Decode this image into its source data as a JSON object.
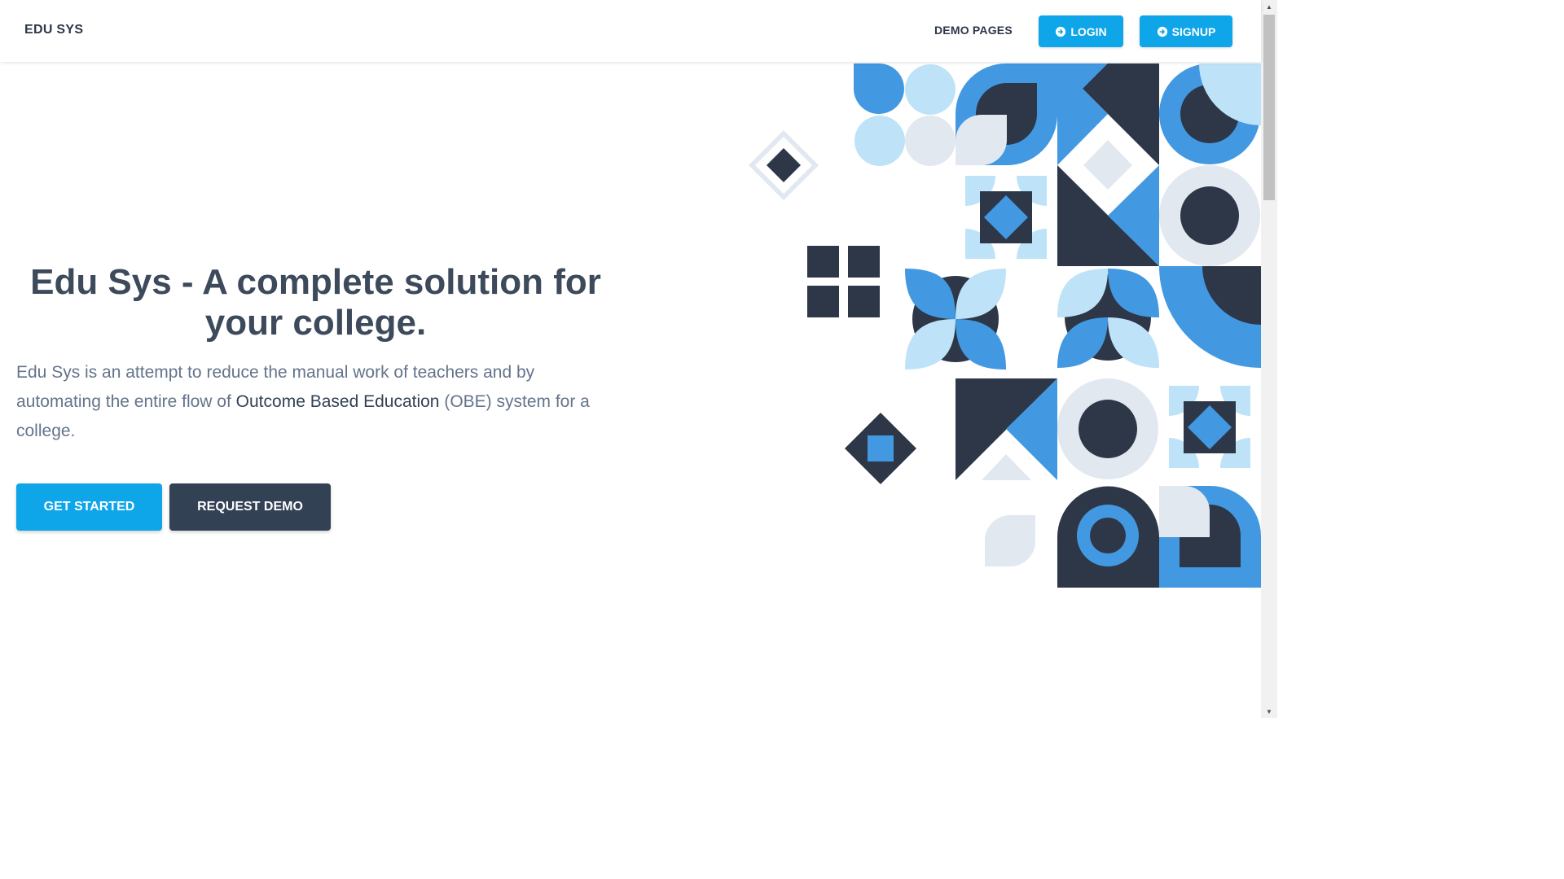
{
  "navbar": {
    "brand": "EDU SYS",
    "demo_pages": "DEMO PAGES",
    "login_label": "LOGIN",
    "signup_label": "SIGNUP"
  },
  "hero": {
    "title": "Edu Sys - A complete solution for your college.",
    "desc_part1": "Edu Sys is an attempt to reduce the manual work of teachers and by automating the entire flow of ",
    "desc_highlight": "Outcome Based Education",
    "desc_part2": " (OBE) system for a college.",
    "get_started": "GET STARTED",
    "request_demo": "REQUEST DEMO"
  },
  "colors": {
    "primary": "#0ea5e9",
    "dark": "#2d3748",
    "pattern_blue": "#4299e1",
    "pattern_light": "#bee3f8",
    "pattern_grey": "#e2e8f0",
    "pattern_dark": "#2d3748"
  }
}
